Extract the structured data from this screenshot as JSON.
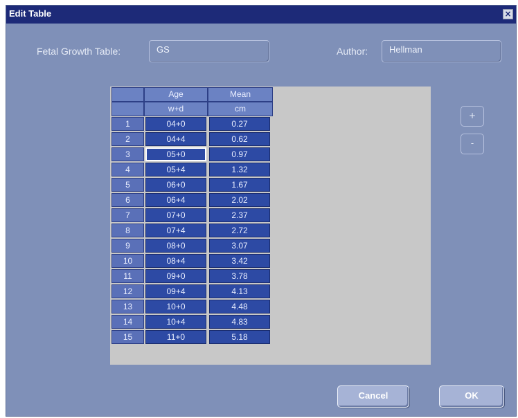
{
  "window": {
    "title": "Edit Table",
    "close_symbol": "×"
  },
  "form": {
    "table_label": "Fetal Growth Table:",
    "table_value": "GS",
    "author_label": "Author:",
    "author_value": "Hellman"
  },
  "table": {
    "columns": [
      {
        "header": "Age",
        "unit": "w+d"
      },
      {
        "header": "Mean",
        "unit": "cm"
      }
    ],
    "rows": [
      {
        "index": "1",
        "age": "04+0",
        "mean": "0.27"
      },
      {
        "index": "2",
        "age": "04+4",
        "mean": "0.62"
      },
      {
        "index": "3",
        "age": "05+0",
        "mean": "0.97"
      },
      {
        "index": "4",
        "age": "05+4",
        "mean": "1.32"
      },
      {
        "index": "5",
        "age": "06+0",
        "mean": "1.67"
      },
      {
        "index": "6",
        "age": "06+4",
        "mean": "2.02"
      },
      {
        "index": "7",
        "age": "07+0",
        "mean": "2.37"
      },
      {
        "index": "8",
        "age": "07+4",
        "mean": "2.72"
      },
      {
        "index": "9",
        "age": "08+0",
        "mean": "3.07"
      },
      {
        "index": "10",
        "age": "08+4",
        "mean": "3.42"
      },
      {
        "index": "11",
        "age": "09+0",
        "mean": "3.78"
      },
      {
        "index": "12",
        "age": "09+4",
        "mean": "4.13"
      },
      {
        "index": "13",
        "age": "10+0",
        "mean": "4.48"
      },
      {
        "index": "14",
        "age": "10+4",
        "mean": "4.83"
      },
      {
        "index": "15",
        "age": "11+0",
        "mean": "5.18"
      }
    ]
  },
  "side_buttons": {
    "add_label": "+",
    "remove_label": "-"
  },
  "buttons": {
    "cancel_label": "Cancel",
    "ok_label": "OK"
  }
}
